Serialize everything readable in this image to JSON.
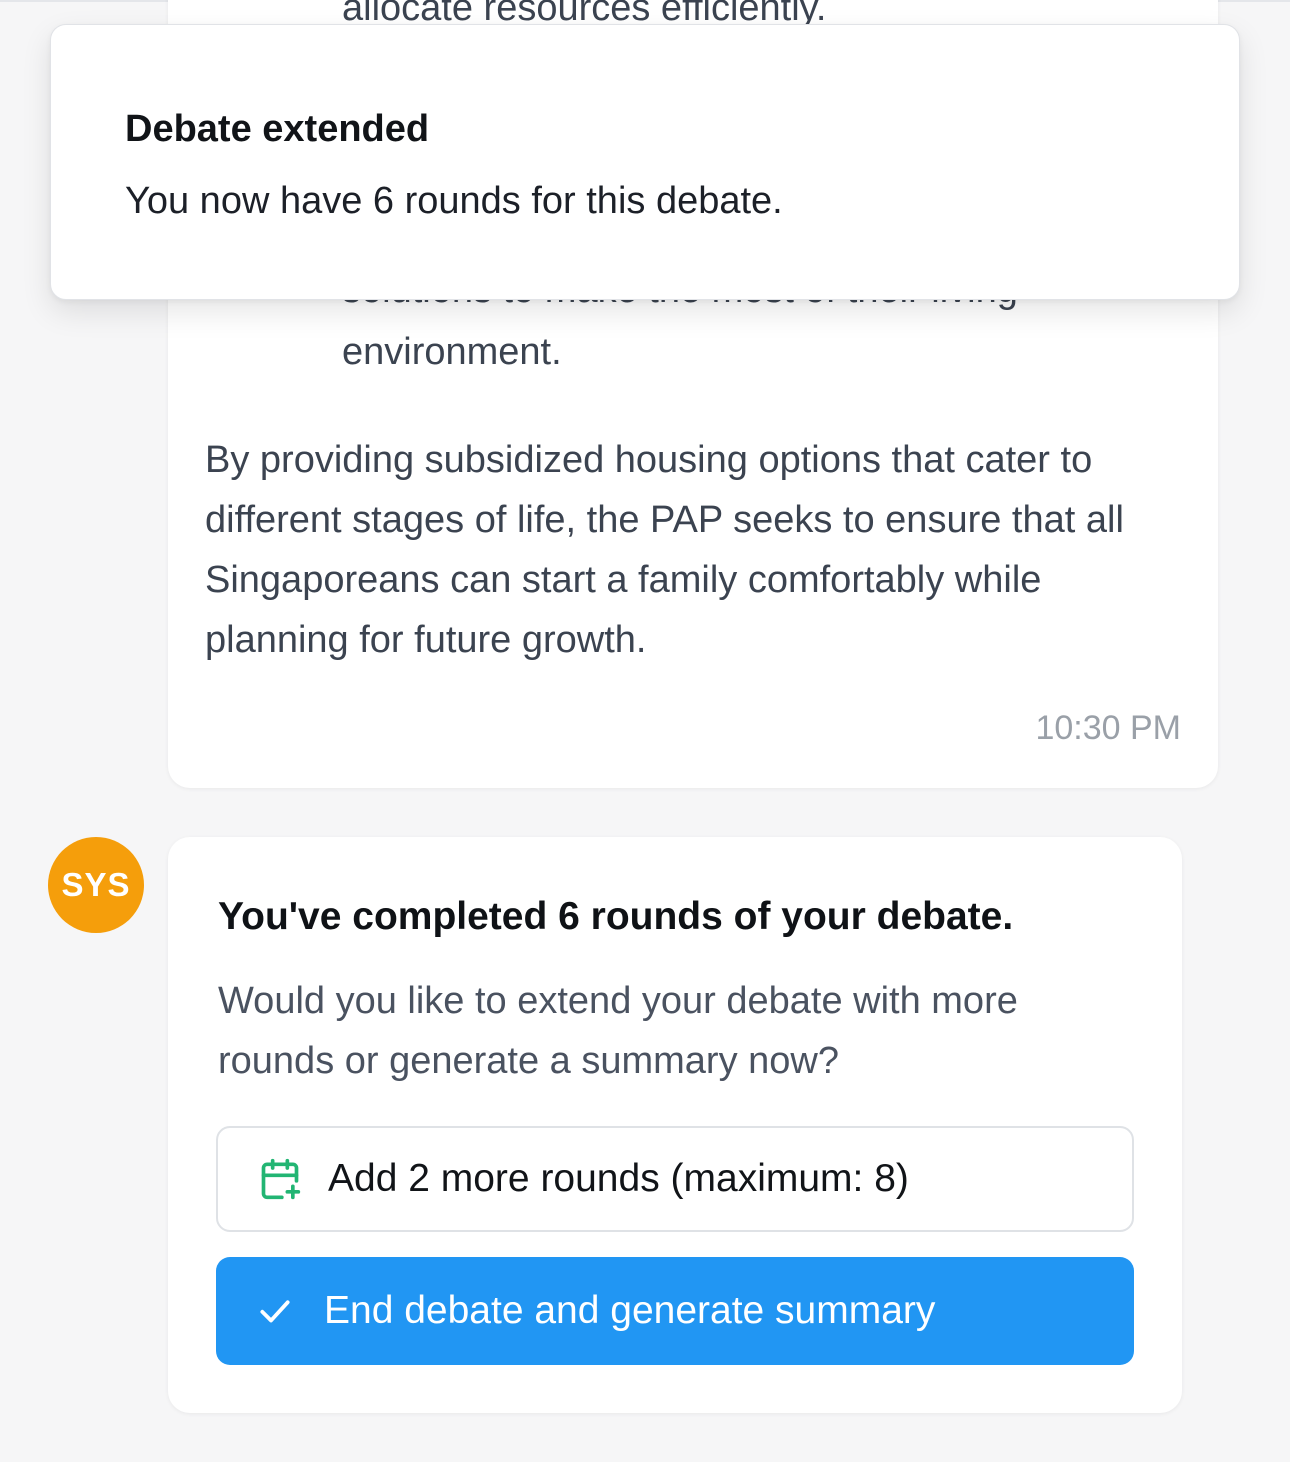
{
  "previous_message": {
    "partial_top_text": "allocate resources efficiently.",
    "partial_mid_text": "solutions to make the most of their living",
    "env_line": "environment.",
    "paragraph": "By providing subsidized housing options that cater to different stages of life, the PAP seeks to ensure that all Singaporeans can start a family comfortably while planning for future growth.",
    "timestamp": "10:30 PM"
  },
  "toast": {
    "title": "Debate extended",
    "description": "You now have 6 rounds for this debate."
  },
  "system_message": {
    "avatar_label": "SYS",
    "title": "You've completed 6 rounds of your debate.",
    "description": "Would you like to extend your debate with more rounds or generate a summary now?",
    "add_rounds_button": {
      "label": "Add 2 more rounds (maximum: 8)",
      "icon": "calendar-plus-icon"
    },
    "end_debate_button": {
      "label": "End debate and generate summary",
      "icon": "check-icon"
    }
  },
  "colors": {
    "avatar_bg": "#f59e0b",
    "primary_button_bg": "#2196f3",
    "calendar_icon": "#22b573",
    "background": "#f6f6f7"
  }
}
